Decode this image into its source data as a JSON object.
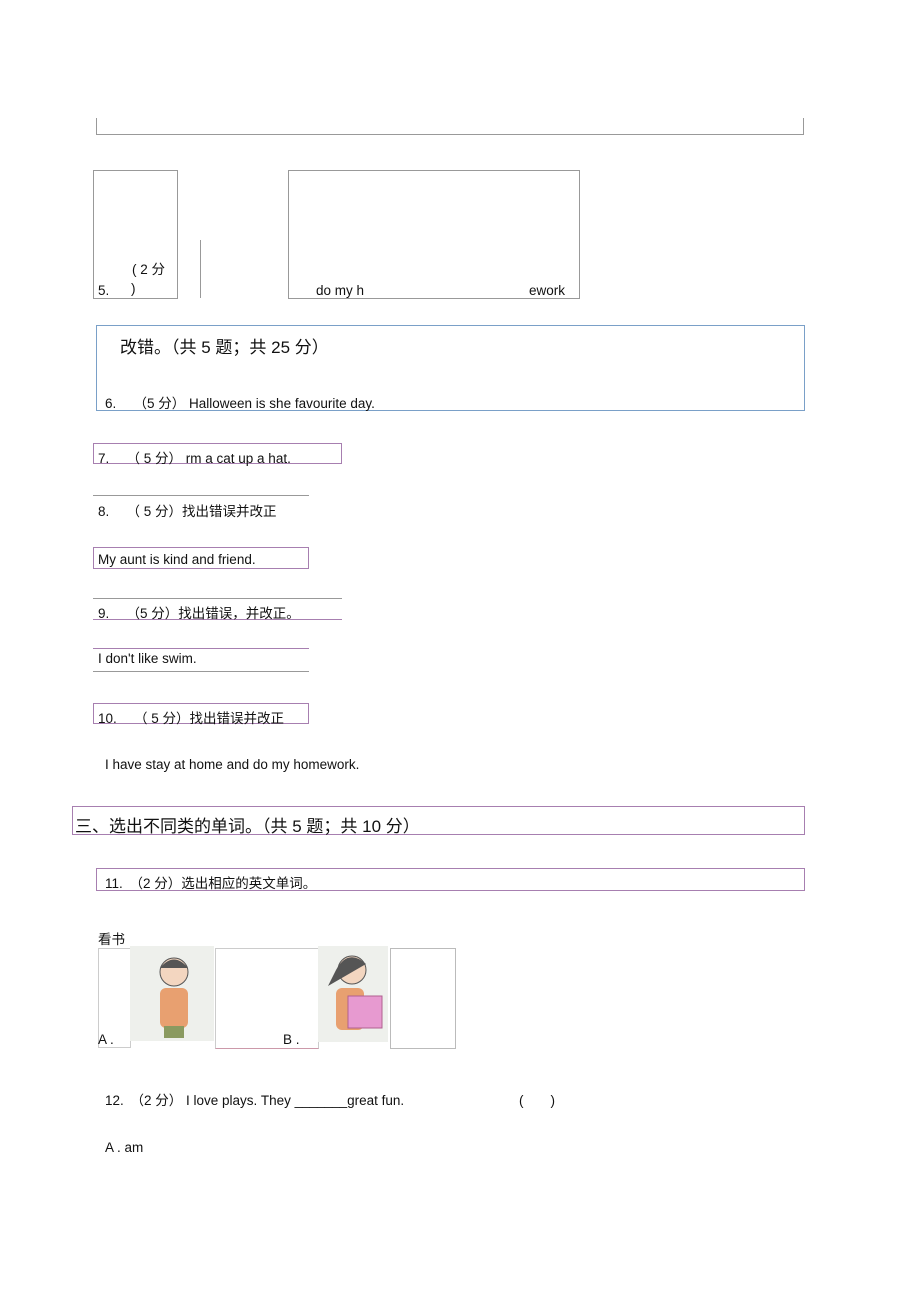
{
  "q5": {
    "number": "5.",
    "score_open": "( 2 分",
    "score_close": ")",
    "text_left": "do my h",
    "text_right": "ework"
  },
  "section2": {
    "title": "改错。（共 5 题；共 25 分）"
  },
  "q6": {
    "text": "6.　 （5 分） Halloween is she favourite day."
  },
  "q7": {
    "text": "7.　 （ 5 分） rm a cat up a hat."
  },
  "q8": {
    "text": "8.　 （ 5 分）找出错误并改正",
    "sentence": "My aunt is kind and friend."
  },
  "q9": {
    "text": "9.　 （5 分）找出错误，并改正。",
    "sentence": "I don't like swim."
  },
  "q10": {
    "text": "10.　 （ 5 分）找出错误并改正",
    "sentence": "I have stay at home and do my homework."
  },
  "section3": {
    "title": "三、选出不同类的单词。（共 5 题；共 10 分）"
  },
  "q11": {
    "text": "11.　（2 分）选出相应的英文单词。",
    "prompt": "看书",
    "option_a": "A .",
    "option_b": "B ."
  },
  "q12": {
    "text": "12.　（2 分） I love plays. They _______great fun.",
    "blank": "(　　)",
    "option_a": "A . am"
  }
}
